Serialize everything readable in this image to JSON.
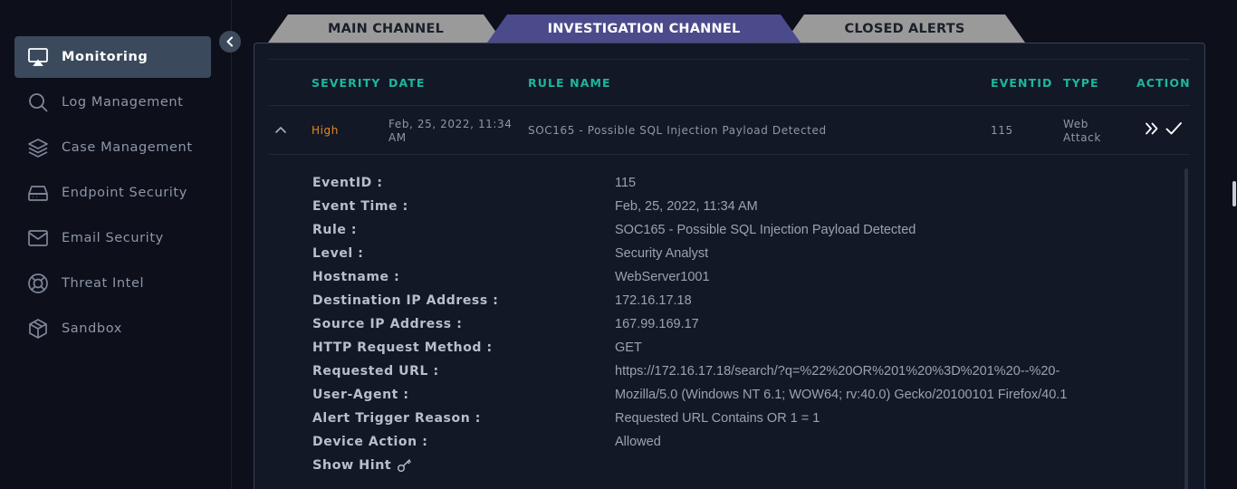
{
  "sidebar": {
    "items": [
      {
        "label": "Monitoring",
        "icon": "monitor-icon"
      },
      {
        "label": "Log Management",
        "icon": "search-icon"
      },
      {
        "label": "Case Management",
        "icon": "layers-icon"
      },
      {
        "label": "Endpoint Security",
        "icon": "hard-drive-icon"
      },
      {
        "label": "Email Security",
        "icon": "envelope-icon"
      },
      {
        "label": "Threat Intel",
        "icon": "lifebuoy-icon"
      },
      {
        "label": "Sandbox",
        "icon": "cube-icon"
      }
    ],
    "active_index": 0
  },
  "tabs": {
    "main": "MAIN CHANNEL",
    "investigation": "INVESTIGATION CHANNEL",
    "closed": "CLOSED ALERTS",
    "active": "investigation"
  },
  "table": {
    "headers": {
      "severity": "SEVERITY",
      "date": "DATE",
      "rule": "RULE NAME",
      "eventid": "EVENTID",
      "type": "TYPE",
      "action": "ACTION"
    },
    "row": {
      "severity": "High",
      "date_line1": "Feb, 25, 2022, 11:34",
      "date_line2": "AM",
      "rule": "SOC165 - Possible SQL Injection Payload Detected",
      "eventid": "115",
      "type_line1": "Web",
      "type_line2": "Attack"
    }
  },
  "details": [
    {
      "label": "EventID :",
      "value": "115"
    },
    {
      "label": "Event Time :",
      "value": "Feb, 25, 2022, 11:34 AM"
    },
    {
      "label": "Rule :",
      "value": "SOC165 - Possible SQL Injection Payload Detected"
    },
    {
      "label": "Level :",
      "value": "Security Analyst"
    },
    {
      "label": "Hostname :",
      "value": "WebServer1001"
    },
    {
      "label": "Destination IP Address :",
      "value": "172.16.17.18"
    },
    {
      "label": "Source IP Address :",
      "value": "167.99.169.17"
    },
    {
      "label": "HTTP Request Method :",
      "value": "GET"
    },
    {
      "label": "Requested URL :",
      "value": "https://172.16.17.18/search/?q=%22%20OR%201%20%3D%201%20--%20-"
    },
    {
      "label": "User-Agent :",
      "value": "Mozilla/5.0 (Windows NT 6.1; WOW64; rv:40.0) Gecko/20100101 Firefox/40.1"
    },
    {
      "label": "Alert Trigger Reason :",
      "value": "Requested URL Contains OR 1 = 1"
    },
    {
      "label": "Device Action :",
      "value": "Allowed"
    }
  ],
  "hint": {
    "label": "Show Hint",
    "icon": "key-icon"
  },
  "colors": {
    "accent_teal": "#1fb59e",
    "severity_high": "#e58a1f",
    "active_tab": "#4a4a8a",
    "inactive_tab": "#9b9b9b",
    "sidebar_active": "#3a4a5c"
  }
}
